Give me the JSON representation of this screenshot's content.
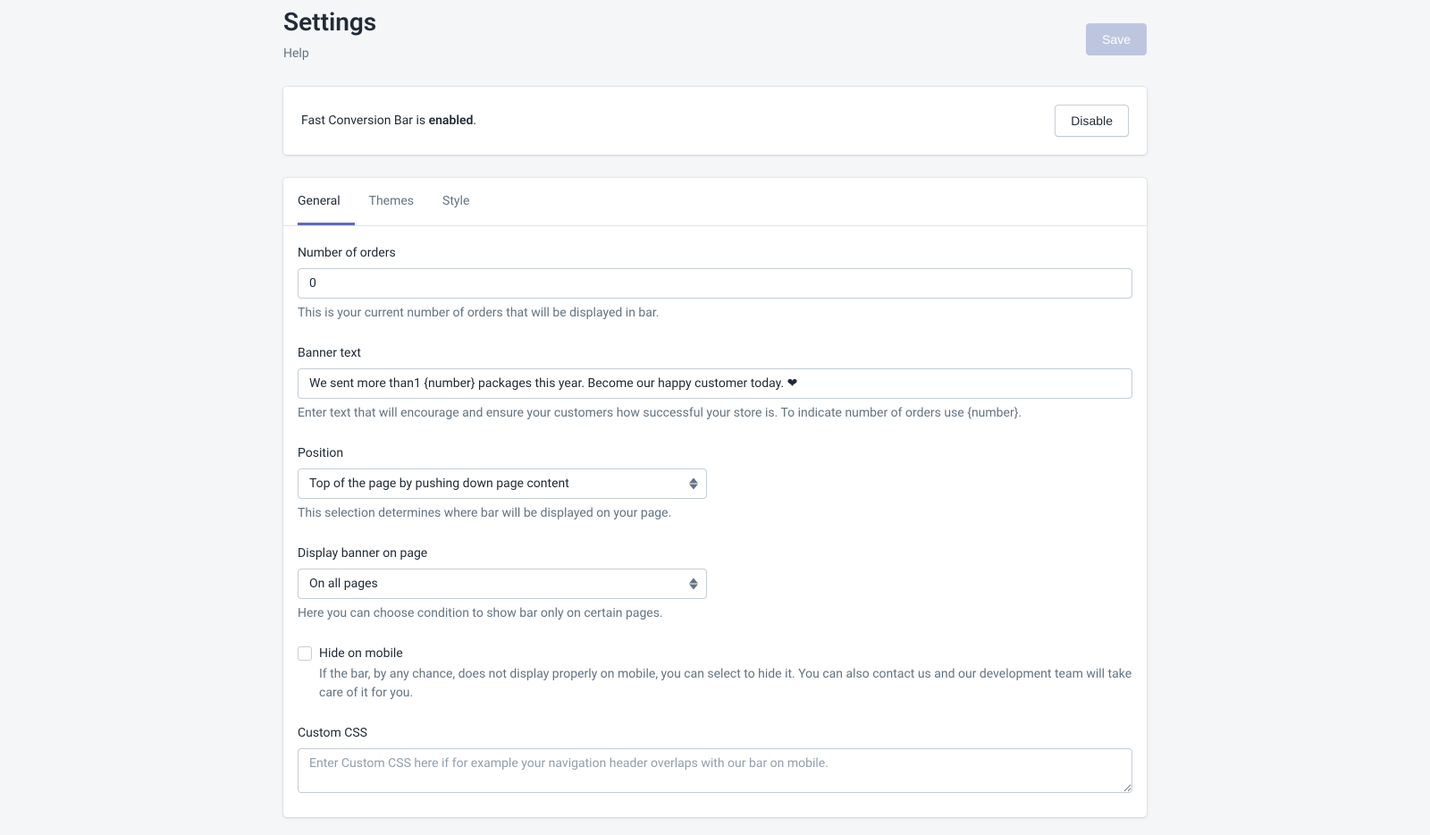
{
  "header": {
    "title": "Settings",
    "help": "Help",
    "save": "Save"
  },
  "status": {
    "prefix": "Fast Conversion Bar is ",
    "state": "enabled",
    "suffix": ".",
    "disable": "Disable"
  },
  "tabs": {
    "general": "General",
    "themes": "Themes",
    "style": "Style"
  },
  "form": {
    "orders": {
      "label": "Number of orders",
      "value": "0",
      "help": "This is your current number of orders that will be displayed in bar."
    },
    "banner": {
      "label": "Banner text",
      "value": "We sent more than1 {number} packages this year. Become our happy customer today. ❤",
      "help": "Enter text that will encourage and ensure your customers how successful your store is. To indicate number of orders use {number}."
    },
    "position": {
      "label": "Position",
      "value": "Top of the page by pushing down page content",
      "help": "This selection determines where bar will be displayed on your page."
    },
    "display": {
      "label": "Display banner on page",
      "value": "On all pages",
      "help": "Here you can choose condition to show bar only on certain pages."
    },
    "hideMobile": {
      "label": "Hide on mobile",
      "help": "If the bar, by any chance, does not display properly on mobile, you can select to hide it. You can also contact us and our development team will take care of it for you."
    },
    "customCss": {
      "label": "Custom CSS",
      "placeholder": "Enter Custom CSS here if for example your navigation header overlaps with our bar on mobile."
    }
  }
}
